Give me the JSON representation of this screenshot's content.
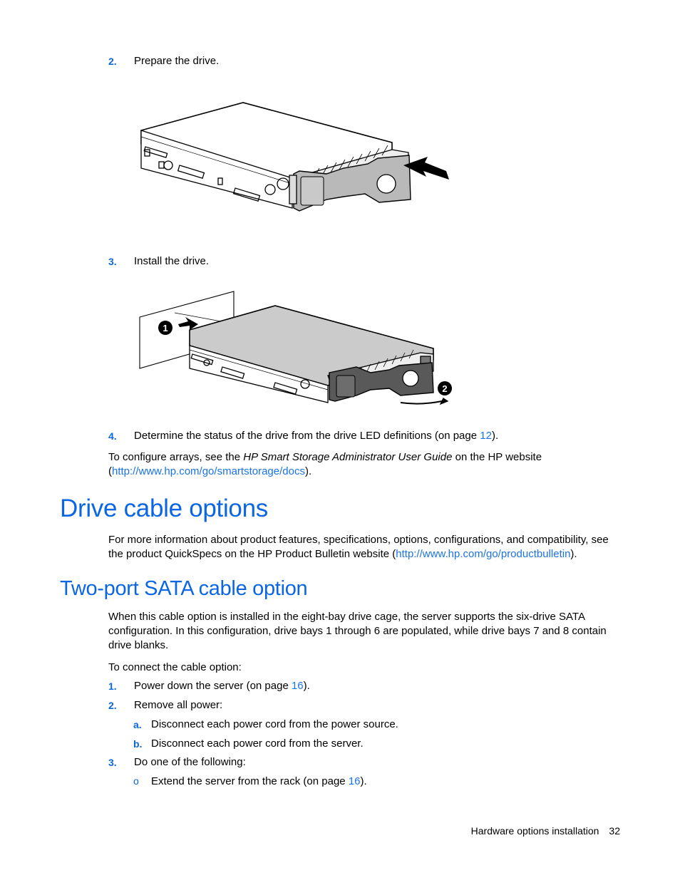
{
  "steps_top": [
    {
      "num": "2.",
      "text": "Prepare the drive."
    },
    {
      "num": "3.",
      "text": "Install the drive."
    },
    {
      "num": "4.",
      "text_before": "Determine the status of the drive from the drive LED definitions (on page ",
      "link": "12",
      "text_after": ")."
    }
  ],
  "figures": {
    "prepare_drive": {
      "alt": "Hot-plug drive with release button being pressed (arrow) to open the drive carrier handle"
    },
    "install_drive": {
      "alt": "Drive being inserted into the bay (callout 1) and handle closed (callout 2)",
      "callouts": [
        "1",
        "2"
      ]
    }
  },
  "configure_arrays": {
    "text_before": "To configure arrays, see the ",
    "italic": "HP Smart Storage Administrator User Guide",
    "text_after": " on the HP website",
    "paren_open": "(",
    "link": "http://www.hp.com/go/smartstorage/docs",
    "paren_close": ")."
  },
  "section_drive_cable": {
    "title": "Drive cable options",
    "para_line1": "For more information about product features, specifications, options, configurations, and compatibility, see",
    "para_line2_before": "the product QuickSpecs on the HP Product Bulletin website (",
    "para_link": "http://www.hp.com/go/productbulletin",
    "para_line2_after": ")."
  },
  "section_two_port": {
    "title": "Two-port SATA cable option",
    "para_lines": [
      "When this cable option is installed in the eight-bay drive cage, the server supports the six-drive SATA",
      "configuration. In this configuration, drive bays 1 through 6 are populated, while drive bays 7 and 8 contain",
      "drive blanks."
    ],
    "intro": "To connect the cable option:",
    "steps": [
      {
        "num": "1.",
        "text_before": "Power down the server (on page ",
        "link": "16",
        "text_after": ")."
      },
      {
        "num": "2.",
        "text": "Remove all power:"
      },
      {
        "num": "a.",
        "text": "Disconnect each power cord from the power source."
      },
      {
        "num": "b.",
        "text": "Disconnect each power cord from the server."
      },
      {
        "num": "3.",
        "text": "Do one of the following:"
      },
      {
        "num": "o",
        "text_before": "Extend the server from the rack (on page ",
        "link": "16",
        "text_after": ")."
      }
    ]
  },
  "footer": {
    "section": "Hardware options installation",
    "page": "32"
  },
  "colors": {
    "heading_blue": "#0b66e4",
    "link_blue": "#1a73e8",
    "number_blue": "#0a67e0"
  }
}
